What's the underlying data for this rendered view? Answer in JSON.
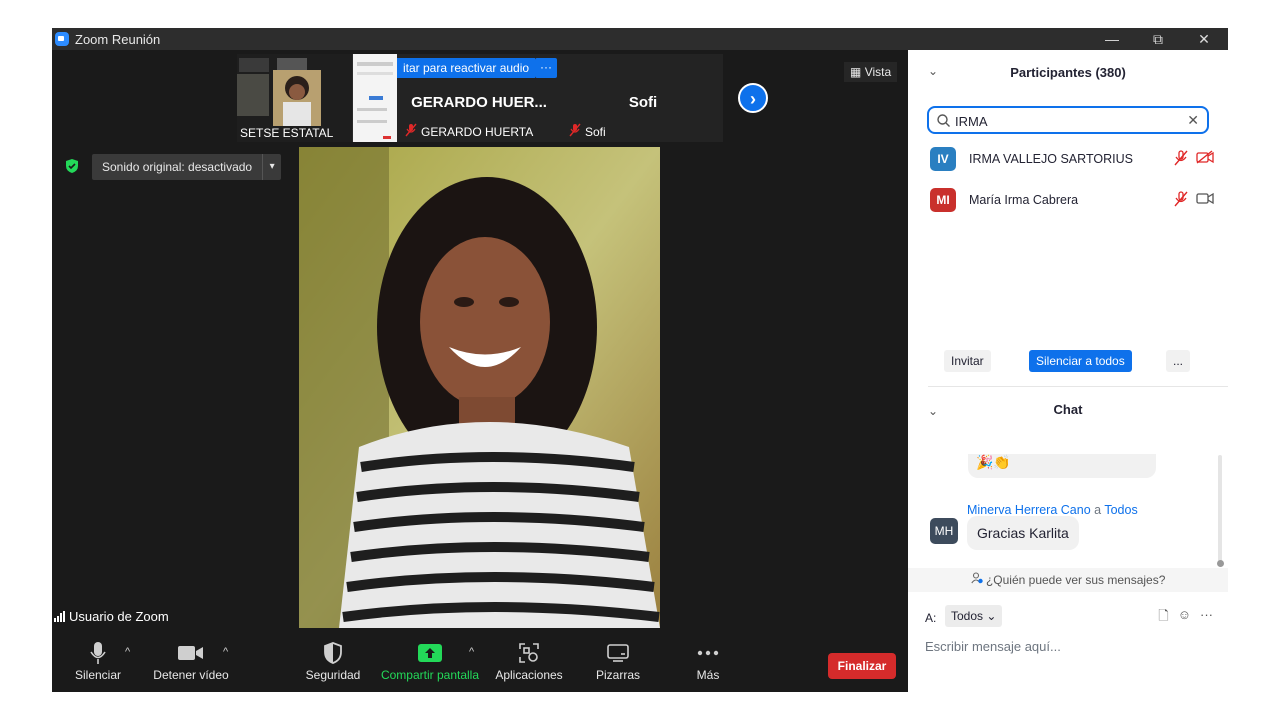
{
  "window": {
    "title": "Zoom Reunión",
    "controls": {
      "minimize": "—",
      "restore": "⧉",
      "close": "✕"
    }
  },
  "gallery": {
    "thumbnails": [
      {
        "name": "SETSE ESTATAL"
      },
      {
        "name": "GERARDO HUER...",
        "label": "GERARDO HUERTA",
        "muted": true
      },
      {
        "name": "Sofi",
        "label": "Sofi",
        "muted": true
      }
    ],
    "unmute_banner": "itar para reactivar audio",
    "more_label": "···",
    "next_label": "›"
  },
  "view_button": "Vista",
  "original_sound": {
    "label": "Sonido original: desactivado",
    "caret": "▾"
  },
  "active_speaker": {
    "label": "Usuario de Zoom"
  },
  "toolbar": {
    "mute": "Silenciar",
    "stop_video": "Detener vídeo",
    "security": "Seguridad",
    "share_screen": "Compartir pantalla",
    "apps": "Aplicaciones",
    "whiteboards": "Pizarras",
    "more": "Más",
    "end": "Finalizar",
    "chevron": "^"
  },
  "participants": {
    "title": "Participantes (380)",
    "collapse": "⌄",
    "search_value": "IRMA",
    "clear": "✕",
    "list": [
      {
        "initials": "IV",
        "name": "IRMA VALLEJO SARTORIUS",
        "avatar_color": "#2a7fc1",
        "mic_muted": true,
        "video_off": true
      },
      {
        "initials": "MI",
        "name": "María Irma Cabrera",
        "avatar_color": "#c9302c",
        "mic_muted": true,
        "video_off": false
      }
    ],
    "invite": "Invitar",
    "mute_all": "Silenciar a todos",
    "more": "..."
  },
  "chat": {
    "title": "Chat",
    "collapse": "⌄",
    "prev_message": "🎉👏",
    "sender": "Minerva Herrera Cano",
    "to_word": "a",
    "recipient": "Todos",
    "message_initials": "MH",
    "message": "Gracias Karlita",
    "who_can_see": "¿Quién puede ver sus mensajes?",
    "to_label": "A:",
    "to_select": "Todos ⌄",
    "tools": {
      "file": "🗋",
      "emoji": "☺",
      "more": "···"
    },
    "input_placeholder": "Escribir mensaje aquí..."
  },
  "colors": {
    "accent": "#0e71eb",
    "end_red": "#d52b2b",
    "share_green": "#23d959",
    "muted_red": "#e02828"
  }
}
